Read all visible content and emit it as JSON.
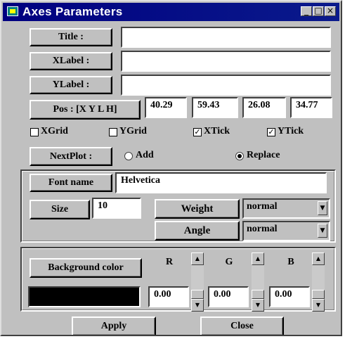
{
  "window": {
    "title": "Axes Parameters"
  },
  "fields": {
    "title_label": "Title :",
    "title_value": "",
    "xlabel_label": "XLabel :",
    "xlabel_value": "",
    "ylabel_label": "YLabel :",
    "ylabel_value": "",
    "pos_label": "Pos : [X Y L H]",
    "pos_values": [
      "40.29",
      "59.43",
      "26.08",
      "34.77"
    ]
  },
  "checkboxes": [
    {
      "label": "XGrid",
      "checked": false
    },
    {
      "label": "YGrid",
      "checked": false
    },
    {
      "label": "XTick",
      "checked": true
    },
    {
      "label": "YTick",
      "checked": true
    }
  ],
  "nextplot": {
    "label": "NextPlot :",
    "options": [
      {
        "label": "Add",
        "selected": false
      },
      {
        "label": "Replace",
        "selected": true
      }
    ]
  },
  "font": {
    "name_label": "Font name",
    "name_value": "Helvetica",
    "size_label": "Size",
    "size_value": "10",
    "weight_label": "Weight",
    "weight_value": "normal",
    "angle_label": "Angle",
    "angle_value": "normal"
  },
  "background": {
    "label": "Background color",
    "color": "#000000",
    "r_label": "R",
    "g_label": "G",
    "b_label": "B",
    "r_value": "0.00",
    "g_value": "0.00",
    "b_value": "0.00"
  },
  "buttons": {
    "apply": "Apply",
    "close": "Close"
  }
}
